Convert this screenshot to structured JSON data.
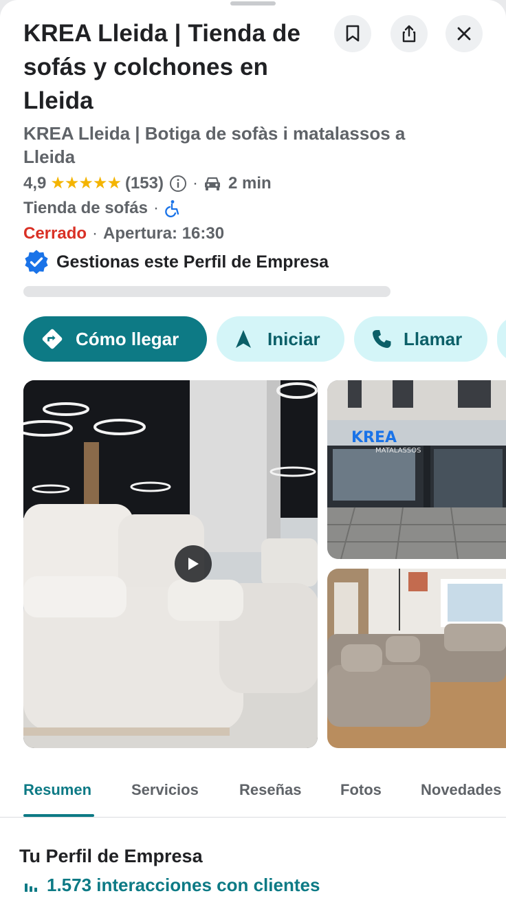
{
  "place": {
    "title": "KREA Lleida | Tienda de sofás y colchones en Lleida",
    "alt_name": "KREA Lleida | Botiga de sofàs i matalassos a Lleida",
    "rating": "4,9",
    "rating_stars": 5,
    "stars": "★★★★★",
    "reviews_count": "(153)",
    "separator": "·",
    "travel_time": "2 min",
    "category": "Tienda de sofás",
    "status": "Cerrado",
    "opening": "Apertura: 16:30",
    "verified_label": "Gestionas este Perfil de Empresa"
  },
  "header": {
    "icons": [
      "bookmark-icon",
      "share-icon",
      "close-icon"
    ]
  },
  "actions": [
    {
      "label": "Cómo llegar",
      "icon": "directions-icon"
    },
    {
      "label": "Iniciar",
      "icon": "navigation-arrow-icon"
    },
    {
      "label": "Llamar",
      "icon": "phone-icon"
    }
  ],
  "tabs": [
    {
      "label": "Resumen",
      "active": true
    },
    {
      "label": "Servicios"
    },
    {
      "label": "Reseñas"
    },
    {
      "label": "Fotos"
    },
    {
      "label": "Novedades"
    }
  ],
  "profile": {
    "heading": "Tu Perfil de Empresa",
    "interactions": "1.573 interacciones con clientes"
  },
  "photos": {
    "storefront_sign_brand": "KREA",
    "storefront_sign_sub": "MATALASSOS"
  },
  "colors": {
    "accent": "#0d7a85",
    "accent_light": "#d4f5f8",
    "closed": "#d93025",
    "star": "#f4b400",
    "verified": "#1a73e8"
  }
}
